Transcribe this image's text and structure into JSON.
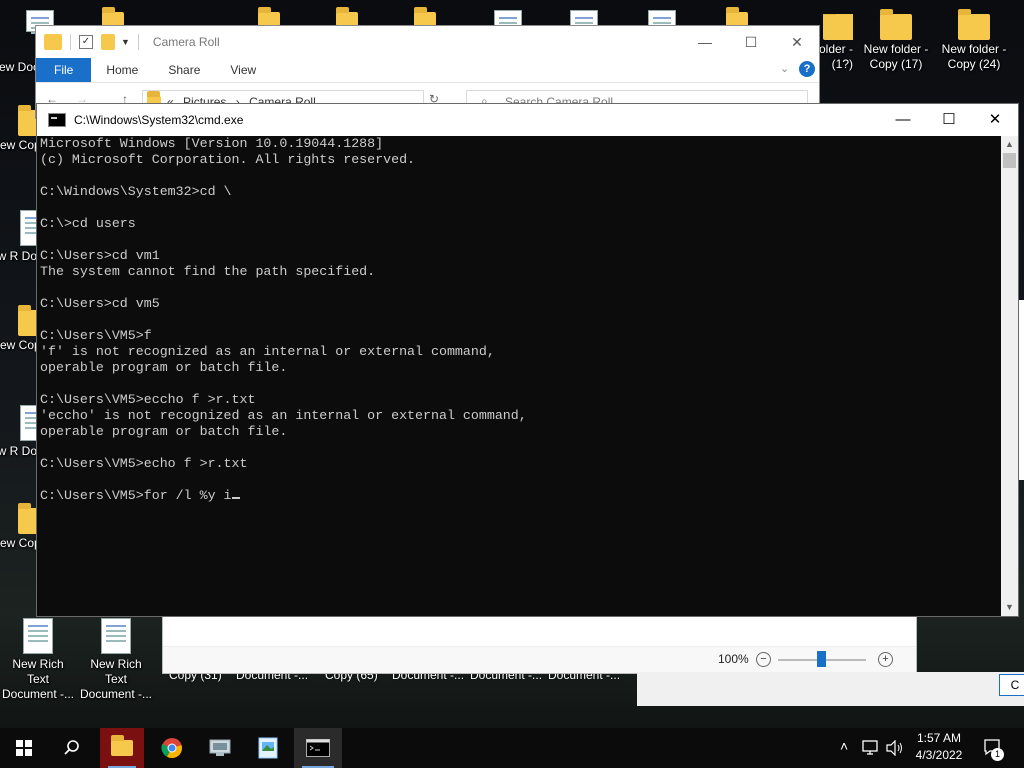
{
  "desktop": {
    "top_icons": [
      {
        "label": "New folder - Copy (17)"
      },
      {
        "label": "New folder - Copy (24)"
      }
    ],
    "partial_top_label": "folder - (1?)",
    "left_labels": [
      "New Docu",
      "New Cop",
      "New R Docu",
      "New Cop",
      "New R Docu",
      "New Cop"
    ],
    "bottom_icons": [
      {
        "label": "New Rich Text Document -..."
      },
      {
        "label": "New Rich Text Document -..."
      }
    ],
    "bottom_partial_labels": [
      "Copy (31)",
      "Document -...",
      "Copy (65)",
      "Document -...",
      "Document -...",
      "Document -..."
    ]
  },
  "explorer": {
    "title": "Camera Roll",
    "ribbon_tabs": [
      "File",
      "Home",
      "Share",
      "View"
    ],
    "breadcrumb": [
      "Pictures",
      "Camera Roll"
    ],
    "breadcrumb_sep": "›",
    "breadcrumb_prefix": "«",
    "search_placeholder": "Search Camera Roll",
    "help_glyph": "?",
    "zoom": "100%",
    "zoom_minus": "−",
    "zoom_plus": "+"
  },
  "dialog": {
    "button_label": "C"
  },
  "cmd": {
    "title": "C:\\Windows\\System32\\cmd.exe",
    "lines": [
      "Microsoft Windows [Version 10.0.19044.1288]",
      "(c) Microsoft Corporation. All rights reserved.",
      "",
      "C:\\Windows\\System32>cd \\",
      "",
      "C:\\>cd users",
      "",
      "C:\\Users>cd vm1",
      "The system cannot find the path specified.",
      "",
      "C:\\Users>cd vm5",
      "",
      "C:\\Users\\VM5>f",
      "'f' is not recognized as an internal or external command,",
      "operable program or batch file.",
      "",
      "C:\\Users\\VM5>eccho f >r.txt",
      "'eccho' is not recognized as an internal or external command,",
      "operable program or batch file.",
      "",
      "C:\\Users\\VM5>echo f >r.txt",
      ""
    ],
    "current_input": "C:\\Users\\VM5>for /l %y i"
  },
  "taskbar": {
    "apps": [
      {
        "icon": "start-icon"
      },
      {
        "icon": "search-icon"
      },
      {
        "icon": "file-explorer-icon"
      },
      {
        "icon": "chrome-icon"
      },
      {
        "icon": "app-icon"
      },
      {
        "icon": "image-app-icon"
      },
      {
        "icon": "cmd-icon"
      }
    ],
    "time": "1:57 AM",
    "date": "4/3/2022",
    "notification_count": "1"
  },
  "colors": {
    "accent": "#1a6fc9",
    "cmd_bg": "#0c0c0c",
    "cmd_fg": "#cccccc"
  }
}
